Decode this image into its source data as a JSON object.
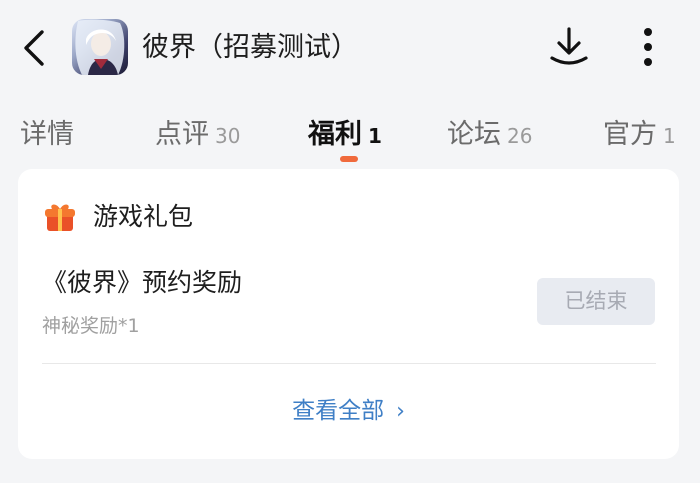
{
  "header": {
    "title": "彼界（招募测试）",
    "icons": {
      "back": "back-arrow-icon",
      "download": "download-icon",
      "more": "more-vertical-icon"
    }
  },
  "tabs": [
    {
      "label": "详情",
      "count": ""
    },
    {
      "label": "点评",
      "count": "30"
    },
    {
      "label": "福利",
      "count": "1",
      "active": true
    },
    {
      "label": "论坛",
      "count": "26"
    },
    {
      "label": "官方",
      "count": "1"
    }
  ],
  "gift_card": {
    "title": "游戏礼包",
    "item": {
      "name": "《彼界》预约奖励",
      "reward": "神秘奖励*1",
      "status": "已结束"
    },
    "view_all": "查看全部",
    "view_all_chevron": "›"
  },
  "colors": {
    "accent": "#f06a3c",
    "link": "#3f7fc6",
    "disabled_bg": "#e8ebf1",
    "background": "#f4f5f7"
  }
}
